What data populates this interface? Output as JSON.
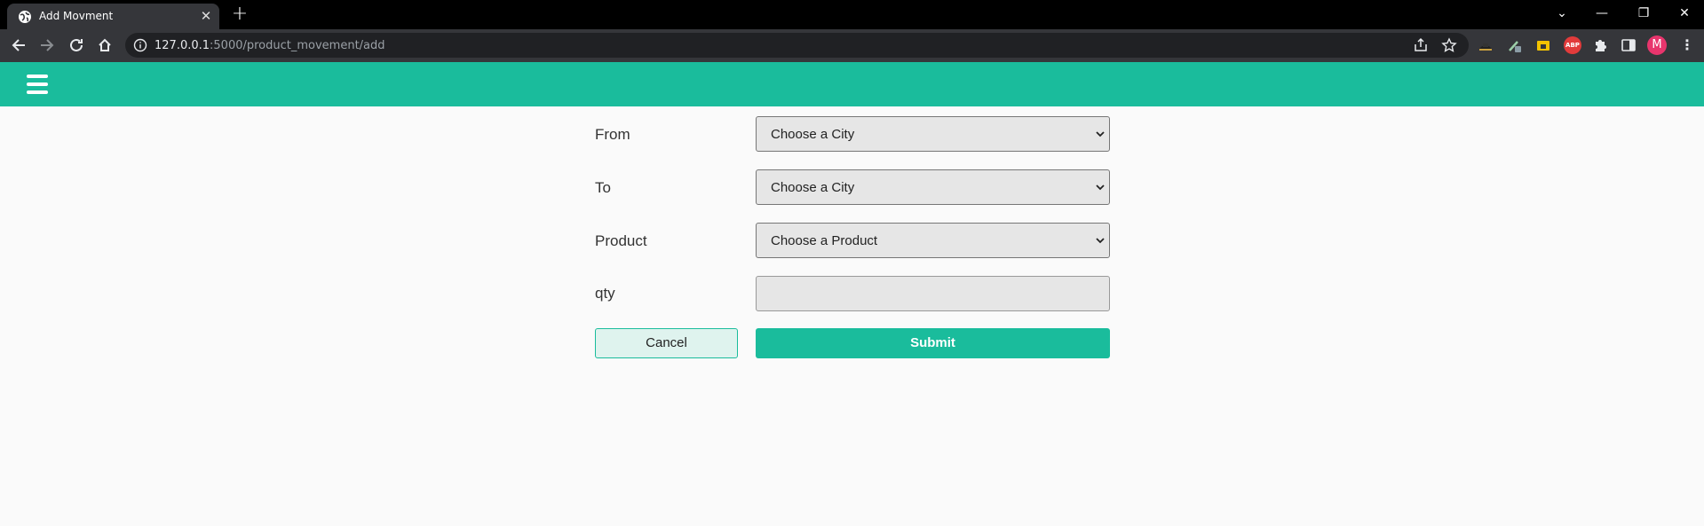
{
  "browser": {
    "tab_title": "Add Movment",
    "url_host": "127.0.0.1",
    "url_rest": ":5000/product_movement/add",
    "profile_initial": "M",
    "extension_abp": "ABP"
  },
  "form": {
    "from_label": "From",
    "from_value": "Choose a City",
    "to_label": "To",
    "to_value": "Choose a City",
    "product_label": "Product",
    "product_value": "Choose a Product",
    "qty_label": "qty",
    "qty_value": "",
    "cancel_label": "Cancel",
    "submit_label": "Submit"
  },
  "colors": {
    "accent": "#1abc9c",
    "page_bg": "#fafafa",
    "field_bg": "#e6e6e6"
  }
}
